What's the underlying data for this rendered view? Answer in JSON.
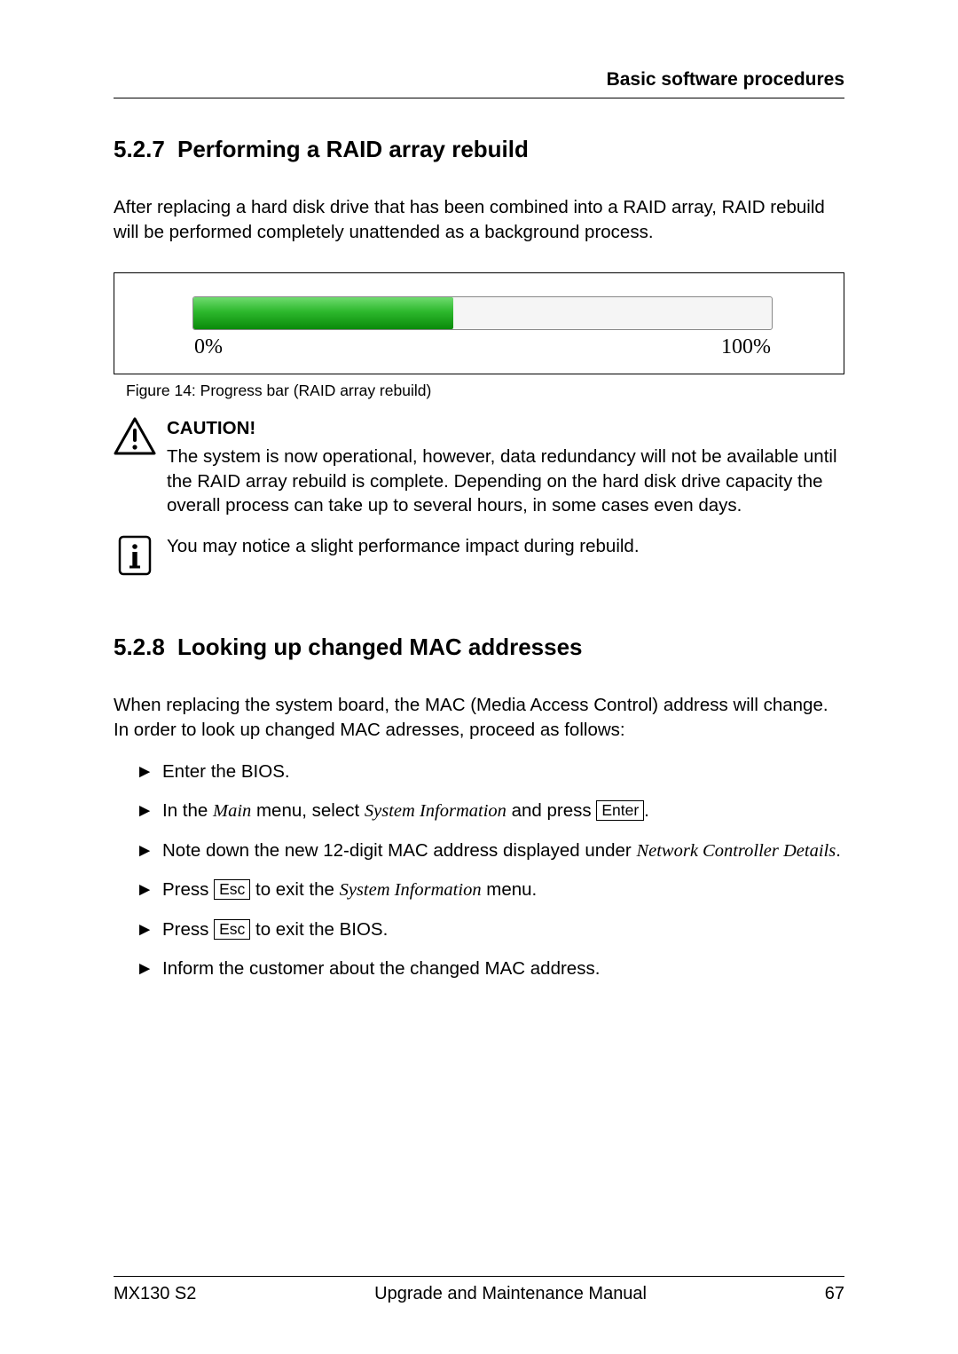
{
  "header": {
    "title": "Basic software procedures"
  },
  "section527": {
    "number": "5.2.7",
    "title": "Performing a RAID array rebuild",
    "intro": "After replacing a hard disk drive that has been combined into a RAID array, RAID rebuild will be performed completely unattended as a background process.",
    "progress": {
      "left_label": "0%",
      "right_label": "100%"
    },
    "figure_caption": "Figure 14: Progress bar (RAID array rebuild)",
    "caution": {
      "label": "CAUTION!",
      "text": "The system is now operational, however, data redundancy will not be available until the RAID array rebuild is complete. Depending on the hard disk drive capacity the overall process can take up to several hours, in some cases even days."
    },
    "info": "You may notice a slight performance impact during rebuild."
  },
  "section528": {
    "number": "5.2.8",
    "title": "Looking up changed MAC addresses",
    "intro": "When replacing the system board, the MAC (Media Access Control) address will change. In order to look up changed MAC adresses, proceed as follows:",
    "steps": {
      "s1": "Enter the BIOS.",
      "s2a": "In the ",
      "s2b": "Main",
      "s2c": " menu, select ",
      "s2d": "System Information",
      "s2e": " and press ",
      "s2key": "Enter",
      "s2f": ".",
      "s3a": "Note down the new 12-digit MAC address displayed under ",
      "s3b": "Network Controller Details",
      "s3c": ".",
      "s4a": "Press ",
      "s4key": "Esc",
      "s4b": " to exit the ",
      "s4c": "System Information",
      "s4d": " menu.",
      "s5a": "Press ",
      "s5key": "Esc",
      "s5b": " to exit the BIOS.",
      "s6": "Inform the customer about the changed MAC address."
    }
  },
  "footer": {
    "left": "MX130 S2",
    "center": "Upgrade and Maintenance Manual",
    "right": "67"
  },
  "chart_data": {
    "type": "bar",
    "title": "Progress bar (RAID array rebuild)",
    "xlabel": "",
    "ylabel": "",
    "range": [
      0,
      100
    ],
    "value_estimate": 45,
    "unit": "%",
    "labels": [
      "0%",
      "100%"
    ]
  }
}
